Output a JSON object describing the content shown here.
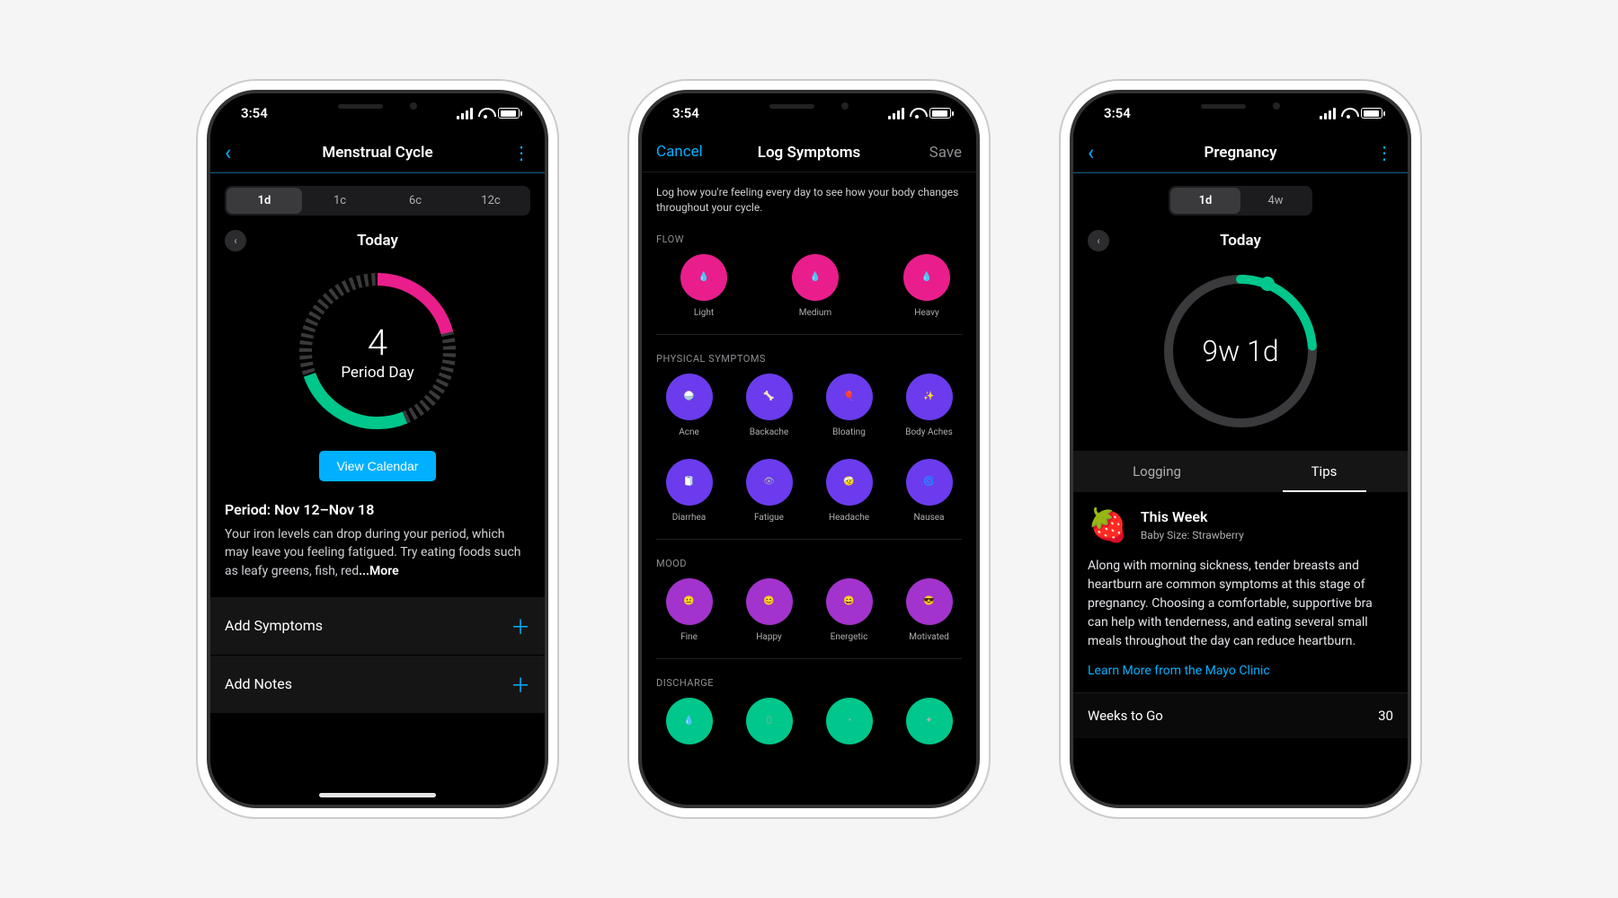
{
  "status": {
    "time": "3:54"
  },
  "screen1": {
    "title": "Menstrual Cycle",
    "segments": [
      "1d",
      "1c",
      "6c",
      "12c"
    ],
    "active_segment": 0,
    "date_label": "Today",
    "ring_value": "4",
    "ring_sub": "Period Day",
    "view_calendar": "View Calendar",
    "period_title": "Period: Nov 12–Nov 18",
    "period_body": "Your iron levels can drop during your period, which may leave you feeling fatigued. Try eating foods such as leafy greens, fish, red",
    "more": "...More",
    "rows": [
      "Add Symptoms",
      "Add Notes"
    ]
  },
  "screen2": {
    "cancel": "Cancel",
    "save": "Save",
    "title": "Log Symptoms",
    "intro": "Log how you're feeling every day to see how your body changes throughout your cycle.",
    "sections": {
      "flow": {
        "label": "FLOW",
        "items": [
          "Light",
          "Medium",
          "Heavy"
        ]
      },
      "physical": {
        "label": "PHYSICAL SYMPTOMS",
        "items": [
          "Acne",
          "Backache",
          "Bloating",
          "Body Aches",
          "Diarrhea",
          "Fatigue",
          "Headache",
          "Nausea"
        ]
      },
      "mood": {
        "label": "MOOD",
        "items": [
          "Fine",
          "Happy",
          "Energetic",
          "Motivated"
        ]
      },
      "discharge": {
        "label": "DISCHARGE"
      }
    }
  },
  "screen3": {
    "title": "Pregnancy",
    "segments": [
      "1d",
      "4w"
    ],
    "active_segment": 0,
    "date_label": "Today",
    "ring_value": "9w 1d",
    "tabs": [
      "Logging",
      "Tips"
    ],
    "active_tab": 1,
    "tip": {
      "icon": "🍓",
      "title": "This Week",
      "subtitle": "Baby Size: Strawberry",
      "body": "Along with morning sickness, tender breasts and heartburn are common symptoms at this stage of pregnancy. Choosing a comfortable, supportive bra can help with tenderness, and eating several small meals throughout the day can reduce heartburn.",
      "link": "Learn More from the Mayo Clinic"
    },
    "stat": {
      "label": "Weeks to Go",
      "value": "30"
    }
  }
}
